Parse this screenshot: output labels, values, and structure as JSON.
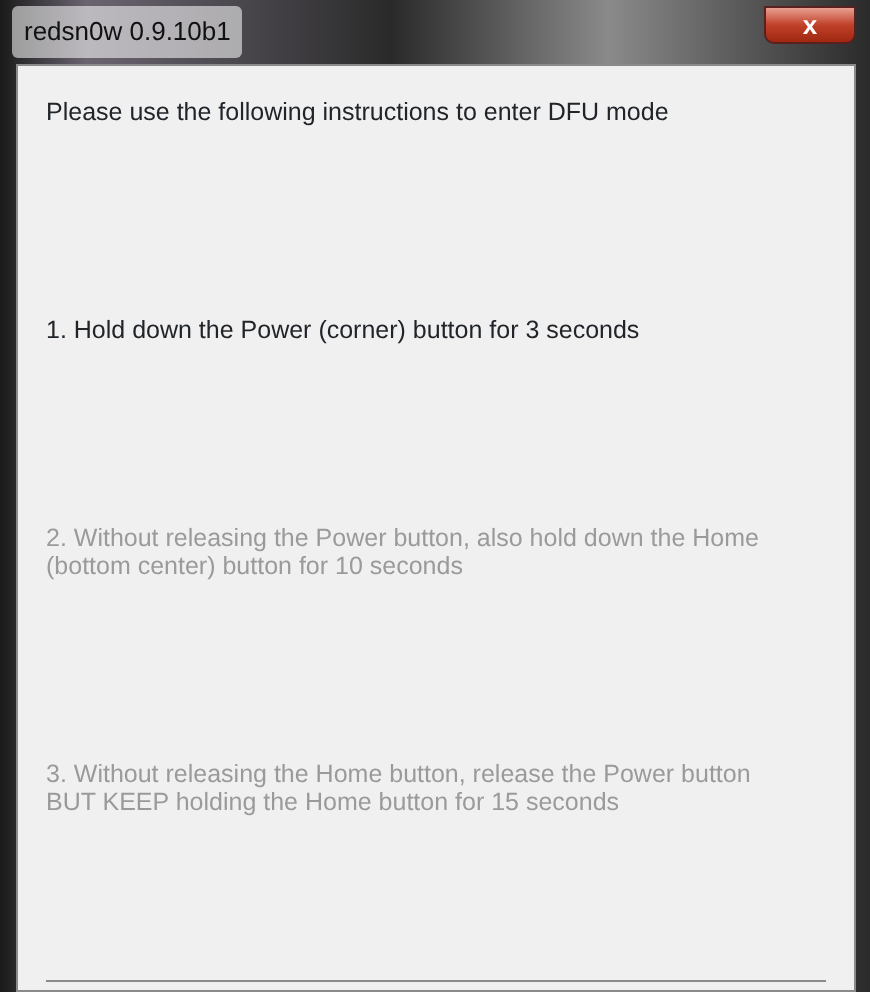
{
  "window": {
    "title": "redsn0w 0.9.10b1",
    "close_label": "x"
  },
  "heading": "Please use the following instructions to enter DFU mode",
  "steps": [
    {
      "text": "1. Hold down the Power (corner) button for 3 seconds",
      "disabled": false
    },
    {
      "text": "2. Without releasing the Power button, also hold down the Home (bottom center) button for 10 seconds",
      "disabled": true
    },
    {
      "text": "3. Without releasing the Home button, release the Power button BUT KEEP holding the Home button for 15 seconds",
      "disabled": true
    }
  ]
}
